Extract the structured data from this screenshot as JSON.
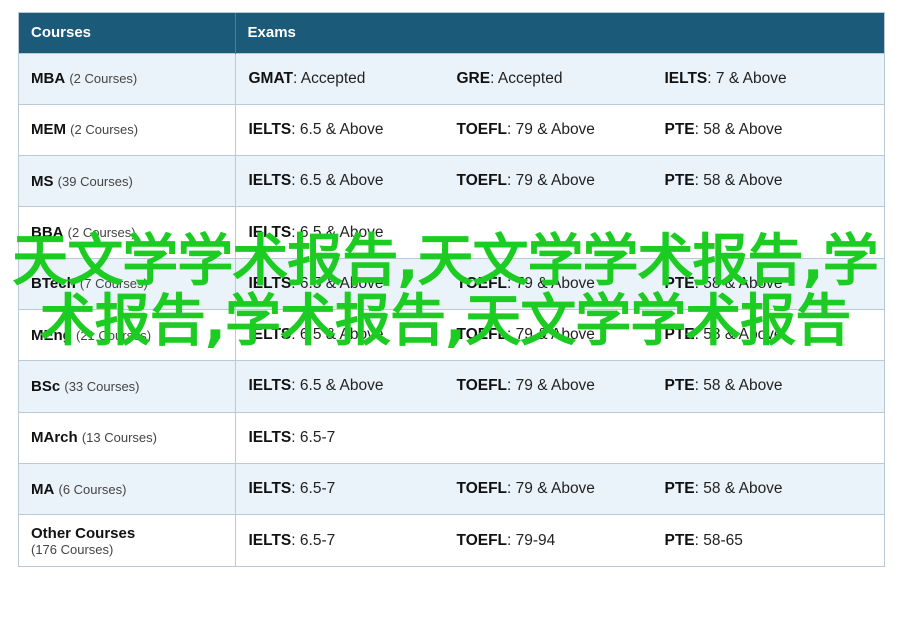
{
  "table": {
    "headers": {
      "courses": "Courses",
      "exams": "Exams"
    },
    "rows": [
      {
        "course": "MBA",
        "count": "(2 Courses)",
        "exams": [
          {
            "name": "GMAT",
            "value": ": Accepted"
          },
          {
            "name": "GRE",
            "value": ": Accepted"
          },
          {
            "name": "IELTS",
            "value": ": 7 & Above"
          }
        ]
      },
      {
        "course": "MEM",
        "count": "(2 Courses)",
        "exams": [
          {
            "name": "IELTS",
            "value": ": 6.5 & Above"
          },
          {
            "name": "TOEFL",
            "value": ": 79 & Above"
          },
          {
            "name": "PTE",
            "value": ": 58 & Above"
          }
        ]
      },
      {
        "course": "MS",
        "count": "(39 Courses)",
        "exams": [
          {
            "name": "IELTS",
            "value": ": 6.5 & Above"
          },
          {
            "name": "TOEFL",
            "value": ": 79 & Above"
          },
          {
            "name": "PTE",
            "value": ": 58 & Above"
          }
        ]
      },
      {
        "course": "BBA",
        "count": "(2 Courses)",
        "exams": [
          {
            "name": "IELTS",
            "value": ": 6.5 & Above"
          }
        ]
      },
      {
        "course": "BTech",
        "count": "(7 Courses)",
        "exams": [
          {
            "name": "IELTS",
            "value": ": 6.5 & Above"
          },
          {
            "name": "TOEFL",
            "value": ": 79 & Above"
          },
          {
            "name": "PTE",
            "value": ": 58 & Above"
          }
        ]
      },
      {
        "course": "MEng",
        "count": "(21 Courses)",
        "exams": [
          {
            "name": "IELTS",
            "value": ": 6.5 & Above"
          },
          {
            "name": "TOEFL",
            "value": ": 79 & Above"
          },
          {
            "name": "PTE",
            "value": ": 58 & Above"
          }
        ]
      },
      {
        "course": "BSc",
        "count": "(33 Courses)",
        "exams": [
          {
            "name": "IELTS",
            "value": ": 6.5 & Above"
          },
          {
            "name": "TOEFL",
            "value": ": 79 & Above"
          },
          {
            "name": "PTE",
            "value": ": 58 & Above"
          }
        ]
      },
      {
        "course": "MArch",
        "count": "(13 Courses)",
        "exams": [
          {
            "name": "IELTS",
            "value": ": 6.5-7"
          }
        ]
      },
      {
        "course": "MA",
        "count": "(6 Courses)",
        "exams": [
          {
            "name": "IELTS",
            "value": ": 6.5-7"
          },
          {
            "name": "TOEFL",
            "value": ": 79 & Above"
          },
          {
            "name": "PTE",
            "value": ": 58 & Above"
          }
        ]
      },
      {
        "course": "Other Courses",
        "count": "(176 Courses)",
        "exams": [
          {
            "name": "IELTS",
            "value": ": 6.5-7"
          },
          {
            "name": "TOEFL",
            "value": ": 79-94"
          },
          {
            "name": "PTE",
            "value": ": 58-65"
          }
        ]
      }
    ]
  },
  "overlay": {
    "text": "天文学学术报告,天文学学术报告,学术报告,学术报告,天文学学术报告",
    "color": "#1dcc23"
  }
}
